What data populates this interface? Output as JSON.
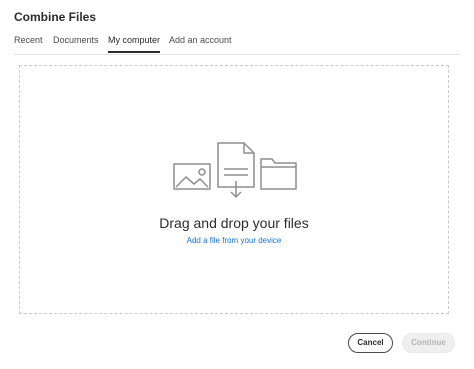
{
  "dialog": {
    "title": "Combine Files"
  },
  "tabs": [
    {
      "label": "Recent",
      "active": false
    },
    {
      "label": "Documents",
      "active": false
    },
    {
      "label": "My computer",
      "active": true
    },
    {
      "label": "Add an account",
      "active": false
    }
  ],
  "dropzone": {
    "title": "Drag and drop your files",
    "link": "Add a file from your device",
    "icons": [
      "image-icon",
      "document-download-icon",
      "folder-icon"
    ]
  },
  "footer": {
    "cancel_label": "Cancel",
    "continue_label": "Continue",
    "continue_enabled": false
  },
  "colors": {
    "link": "#1473e6",
    "text": "#2c2c2c",
    "border_dashed": "#c9c9c9",
    "icon_stroke": "#8e8e8e"
  }
}
